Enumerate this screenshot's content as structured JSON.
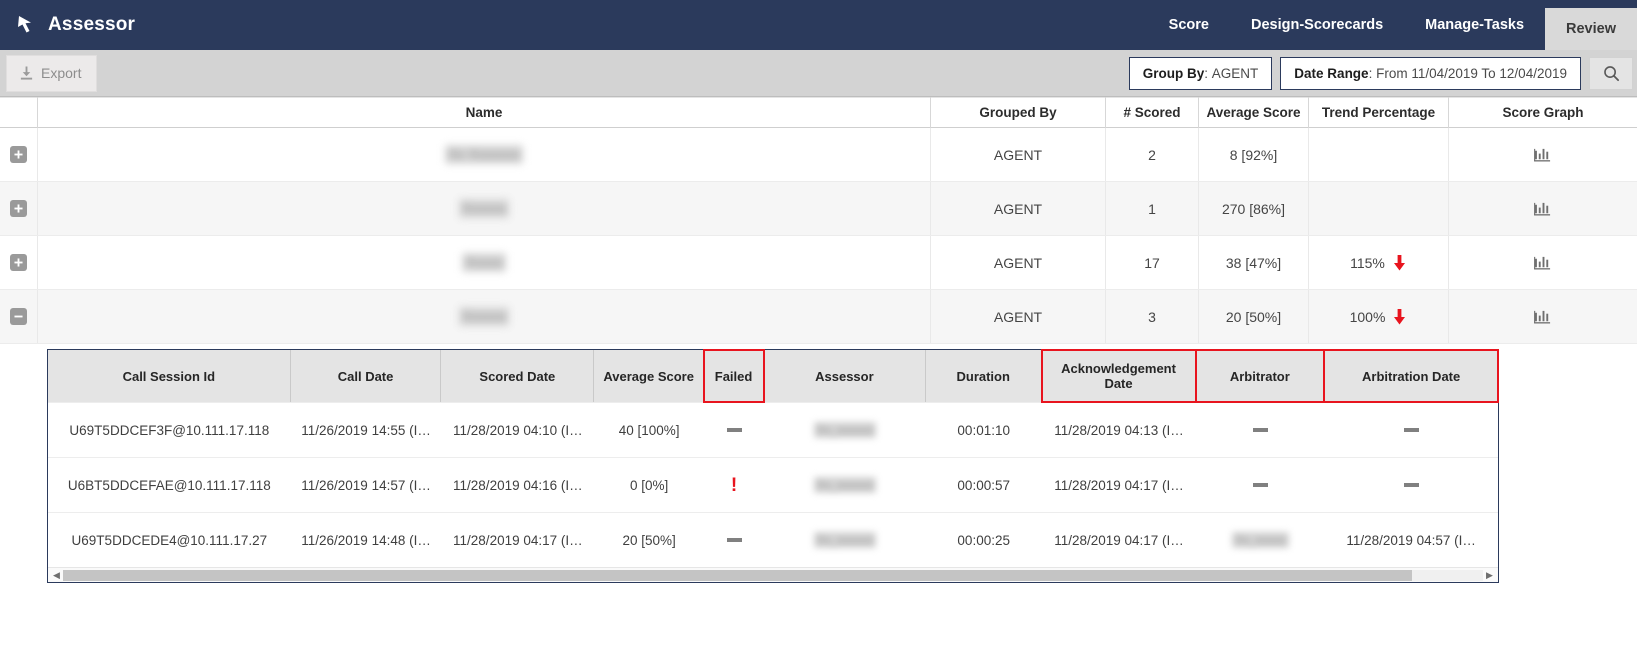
{
  "header": {
    "app_title": "Assessor",
    "logo_icon": "cursor-arrow-icon",
    "nav": [
      {
        "label": "Score",
        "active": false
      },
      {
        "label": "Design-Scorecards",
        "active": false
      },
      {
        "label": "Manage-Tasks",
        "active": false
      },
      {
        "label": "Review",
        "active": true
      }
    ]
  },
  "toolbar": {
    "export_label": "Export",
    "export_icon": "download-icon",
    "group_by_label": "Group By",
    "group_by_value": "AGENT",
    "date_range_label": "Date Range",
    "date_range_value": "From 11/04/2019 To 12/04/2019",
    "search_icon": "search-icon"
  },
  "grid": {
    "columns": [
      "Name",
      "Grouped By",
      "# Scored",
      "Average Score",
      "Trend Percentage",
      "Score Graph"
    ],
    "rows": [
      {
        "name": "",
        "grouped_by": "AGENT",
        "scored": "2",
        "average_score": "8 [92%]",
        "trend": "",
        "expanded": false
      },
      {
        "name": "",
        "grouped_by": "AGENT",
        "scored": "1",
        "average_score": "270 [86%]",
        "trend": "",
        "expanded": false
      },
      {
        "name": "",
        "grouped_by": "AGENT",
        "scored": "17",
        "average_score": "38 [47%]",
        "trend": "115%",
        "expanded": false
      },
      {
        "name": "",
        "grouped_by": "AGENT",
        "scored": "3",
        "average_score": "20 [50%]",
        "trend": "100%",
        "expanded": true
      }
    ]
  },
  "detail": {
    "columns": [
      {
        "label": "Call Session Id",
        "highlighted": false
      },
      {
        "label": "Call Date",
        "highlighted": false
      },
      {
        "label": "Scored Date",
        "highlighted": false
      },
      {
        "label": "Average Score",
        "highlighted": false
      },
      {
        "label": "Failed",
        "highlighted": true
      },
      {
        "label": "Assessor",
        "highlighted": false
      },
      {
        "label": "Duration",
        "highlighted": false
      },
      {
        "label": "Acknowledgement Date",
        "highlighted": true
      },
      {
        "label": "Arbitrator",
        "highlighted": true
      },
      {
        "label": "Arbitration Date",
        "highlighted": true
      }
    ],
    "rows": [
      {
        "call_session_id": "U69T5DDCEF3F@10.111.17.118",
        "call_date": "11/26/2019 14:55 (I…",
        "scored_date": "11/28/2019 04:10 (I…",
        "average_score": "40 [100%]",
        "failed": "dash",
        "assessor": "",
        "duration": "00:01:10",
        "acknowledgement_date": "11/28/2019 04:13 (I…",
        "arbitrator": "dash",
        "arbitration_date": "dash"
      },
      {
        "call_session_id": "U6BT5DDCEFAE@10.111.17.118",
        "call_date": "11/26/2019 14:57 (I…",
        "scored_date": "11/28/2019 04:16 (I…",
        "average_score": "0 [0%]",
        "failed": "alert",
        "assessor": "",
        "duration": "00:00:57",
        "acknowledgement_date": "11/28/2019 04:17 (I…",
        "arbitrator": "dash",
        "arbitration_date": "dash"
      },
      {
        "call_session_id": "U69T5DDCEDE4@10.111.17.27",
        "call_date": "11/26/2019 14:48 (I…",
        "scored_date": "11/28/2019 04:17 (I…",
        "average_score": "20 [50%]",
        "failed": "dash",
        "assessor": "",
        "duration": "00:00:25",
        "acknowledgement_date": "11/28/2019 04:17 (I…",
        "arbitrator": "blurred",
        "arbitration_date": "11/28/2019 04:57 (I…"
      }
    ],
    "scroll_left_icon": "chevron-left-icon",
    "scroll_right_icon": "chevron-right-icon"
  },
  "colors": {
    "navy": "#2b3a5c",
    "highlight_red": "#e8141e",
    "toolbar_gray": "#d3d3d3",
    "active_tab": "#d9d9d9"
  }
}
